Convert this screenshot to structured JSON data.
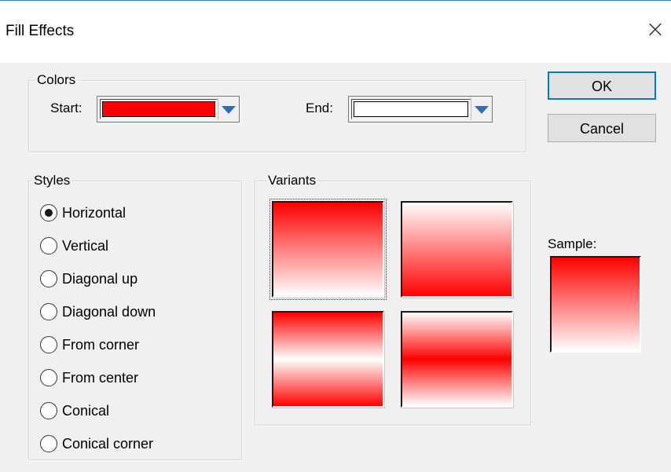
{
  "window": {
    "title": "Fill Effects",
    "close_glyph": "×"
  },
  "colors": {
    "legend": "Colors",
    "start_label": "Start:",
    "end_label": "End:",
    "start_color": "#ff0000",
    "end_color": "#ffffff"
  },
  "buttons": {
    "ok": "OK",
    "cancel": "Cancel"
  },
  "styles": {
    "legend": "Styles",
    "selected": "Horizontal",
    "options": [
      "Horizontal",
      "Vertical",
      "Diagonal up",
      "Diagonal down",
      "From corner",
      "From center",
      "Conical",
      "Conical corner"
    ]
  },
  "variants": {
    "legend": "Variants",
    "items": [
      {
        "name": "red-to-white",
        "selected": true
      },
      {
        "name": "white-to-red",
        "selected": false
      },
      {
        "name": "red-white-red",
        "selected": false
      },
      {
        "name": "white-red-white",
        "selected": false
      }
    ]
  },
  "sample": {
    "label": "Sample:"
  }
}
